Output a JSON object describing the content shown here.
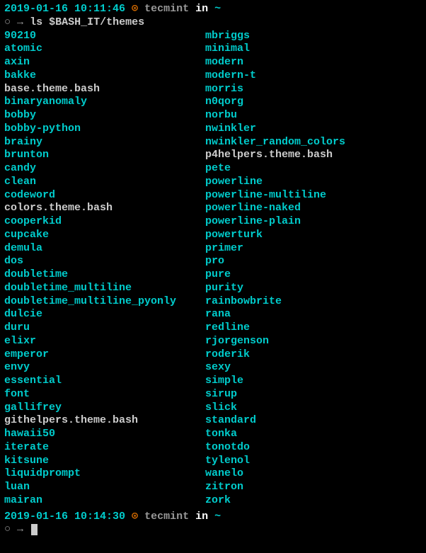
{
  "prompt1": {
    "timestamp": "2019-01-16 10:11:46",
    "clock": "⊙",
    "user": "tecmint",
    "in_text": "in",
    "path": "~",
    "circle": "○",
    "arrow": "→",
    "command": "ls $BASH_IT/themes"
  },
  "listing": {
    "col1": [
      {
        "name": "90210",
        "type": "dir"
      },
      {
        "name": "atomic",
        "type": "dir"
      },
      {
        "name": "axin",
        "type": "dir"
      },
      {
        "name": "bakke",
        "type": "dir"
      },
      {
        "name": "base.theme.bash",
        "type": "file"
      },
      {
        "name": "binaryanomaly",
        "type": "dir"
      },
      {
        "name": "bobby",
        "type": "dir"
      },
      {
        "name": "bobby-python",
        "type": "dir"
      },
      {
        "name": "brainy",
        "type": "dir"
      },
      {
        "name": "brunton",
        "type": "dir"
      },
      {
        "name": "candy",
        "type": "dir"
      },
      {
        "name": "clean",
        "type": "dir"
      },
      {
        "name": "codeword",
        "type": "dir"
      },
      {
        "name": "colors.theme.bash",
        "type": "file"
      },
      {
        "name": "cooperkid",
        "type": "dir"
      },
      {
        "name": "cupcake",
        "type": "dir"
      },
      {
        "name": "demula",
        "type": "dir"
      },
      {
        "name": "dos",
        "type": "dir"
      },
      {
        "name": "doubletime",
        "type": "dir"
      },
      {
        "name": "doubletime_multiline",
        "type": "dir"
      },
      {
        "name": "doubletime_multiline_pyonly",
        "type": "dir"
      },
      {
        "name": "dulcie",
        "type": "dir"
      },
      {
        "name": "duru",
        "type": "dir"
      },
      {
        "name": "elixr",
        "type": "dir"
      },
      {
        "name": "emperor",
        "type": "dir"
      },
      {
        "name": "envy",
        "type": "dir"
      },
      {
        "name": "essential",
        "type": "dir"
      },
      {
        "name": "font",
        "type": "dir"
      },
      {
        "name": "gallifrey",
        "type": "dir"
      },
      {
        "name": "githelpers.theme.bash",
        "type": "file"
      },
      {
        "name": "hawaii50",
        "type": "dir"
      },
      {
        "name": "iterate",
        "type": "dir"
      },
      {
        "name": "kitsune",
        "type": "dir"
      },
      {
        "name": "liquidprompt",
        "type": "dir"
      },
      {
        "name": "luan",
        "type": "dir"
      },
      {
        "name": "mairan",
        "type": "dir"
      }
    ],
    "col2": [
      {
        "name": "mbriggs",
        "type": "dir"
      },
      {
        "name": "minimal",
        "type": "dir"
      },
      {
        "name": "modern",
        "type": "dir"
      },
      {
        "name": "modern-t",
        "type": "dir"
      },
      {
        "name": "morris",
        "type": "dir"
      },
      {
        "name": "n0qorg",
        "type": "dir"
      },
      {
        "name": "norbu",
        "type": "dir"
      },
      {
        "name": "nwinkler",
        "type": "dir"
      },
      {
        "name": "nwinkler_random_colors",
        "type": "dir"
      },
      {
        "name": "p4helpers.theme.bash",
        "type": "file"
      },
      {
        "name": "pete",
        "type": "dir"
      },
      {
        "name": "powerline",
        "type": "dir"
      },
      {
        "name": "powerline-multiline",
        "type": "dir"
      },
      {
        "name": "powerline-naked",
        "type": "dir"
      },
      {
        "name": "powerline-plain",
        "type": "dir"
      },
      {
        "name": "powerturk",
        "type": "dir"
      },
      {
        "name": "primer",
        "type": "dir"
      },
      {
        "name": "pro",
        "type": "dir"
      },
      {
        "name": "pure",
        "type": "dir"
      },
      {
        "name": "purity",
        "type": "dir"
      },
      {
        "name": "rainbowbrite",
        "type": "dir"
      },
      {
        "name": "rana",
        "type": "dir"
      },
      {
        "name": "redline",
        "type": "dir"
      },
      {
        "name": "rjorgenson",
        "type": "dir"
      },
      {
        "name": "roderik",
        "type": "dir"
      },
      {
        "name": "sexy",
        "type": "dir"
      },
      {
        "name": "simple",
        "type": "dir"
      },
      {
        "name": "sirup",
        "type": "dir"
      },
      {
        "name": "slick",
        "type": "dir"
      },
      {
        "name": "standard",
        "type": "dir"
      },
      {
        "name": "tonka",
        "type": "dir"
      },
      {
        "name": "tonotdo",
        "type": "dir"
      },
      {
        "name": "tylenol",
        "type": "dir"
      },
      {
        "name": "wanelo",
        "type": "dir"
      },
      {
        "name": "zitron",
        "type": "dir"
      },
      {
        "name": "zork",
        "type": "dir"
      }
    ]
  },
  "prompt2": {
    "timestamp": "2019-01-16 10:14:30",
    "clock": "⊙",
    "user": "tecmint",
    "in_text": "in",
    "path": "~",
    "circle": "○",
    "arrow": "→"
  }
}
